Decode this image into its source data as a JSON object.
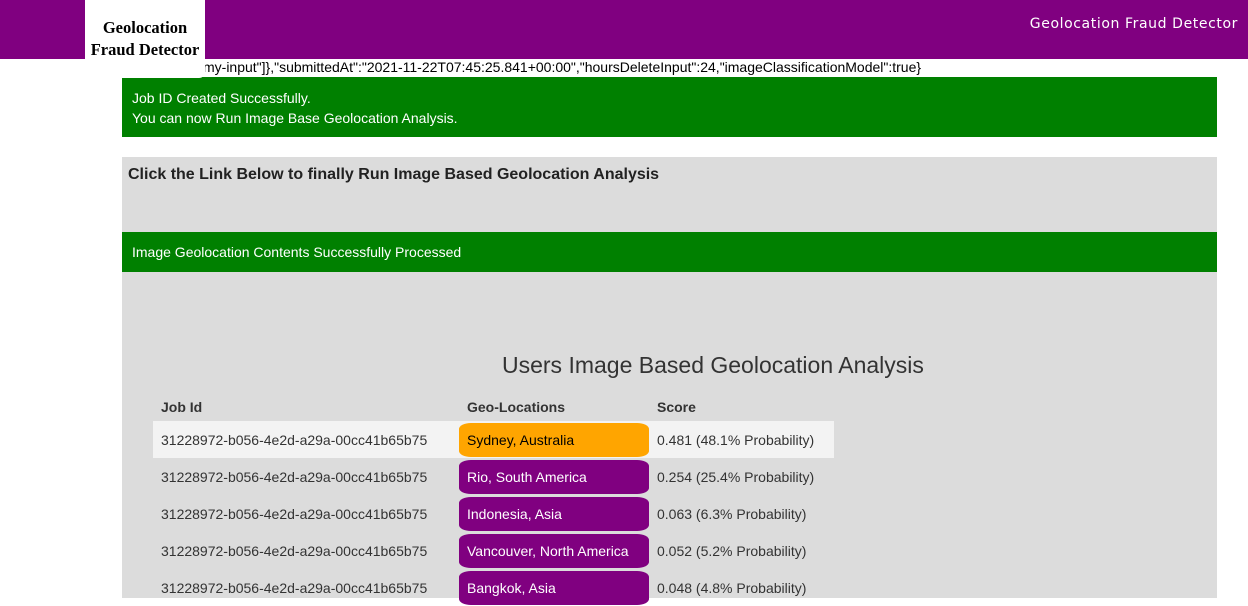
{
  "header": {
    "logo_text": "Geolocation Fraud Detector",
    "app_title": "Geolocation Fraud Detector",
    "brand_color": "#800080"
  },
  "json_line": "my-input\"]},\"submittedAt\":\"2021-11-22T07:45:25.841+00:00\",\"hoursDeleteInput\":24,\"imageClassificationModel\":true}",
  "job_alert": {
    "line1": "Job ID Created Successfully.",
    "line2": "You can now Run Image Base Geolocation Analysis."
  },
  "panel": {
    "link_heading": "Click the Link Below to finally Run Image Based Geolocation Analysis",
    "success_alert": "Image Geolocation Contents Successfully Processed",
    "analysis_title": "Users Image Based Geolocation Analysis"
  },
  "table": {
    "headers": [
      "Job Id",
      "Geo-Locations",
      "Score"
    ],
    "rows": [
      {
        "job_id": "31228972-b056-4e2d-a29a-00cc41b65b75",
        "location": "Sydney, Australia",
        "score": "0.481 (48.1% Probability)",
        "color": "#ffa500"
      },
      {
        "job_id": "31228972-b056-4e2d-a29a-00cc41b65b75",
        "location": "Rio, South America",
        "score": "0.254 (25.4% Probability)",
        "color": "#800080"
      },
      {
        "job_id": "31228972-b056-4e2d-a29a-00cc41b65b75",
        "location": "Indonesia, Asia",
        "score": "0.063 (6.3% Probability)",
        "color": "#800080"
      },
      {
        "job_id": "31228972-b056-4e2d-a29a-00cc41b65b75",
        "location": "Vancouver, North America",
        "score": "0.052 (5.2% Probability)",
        "color": "#800080"
      },
      {
        "job_id": "31228972-b056-4e2d-a29a-00cc41b65b75",
        "location": "Bangkok, Asia",
        "score": "0.048 (4.8% Probability)",
        "color": "#800080"
      }
    ]
  }
}
